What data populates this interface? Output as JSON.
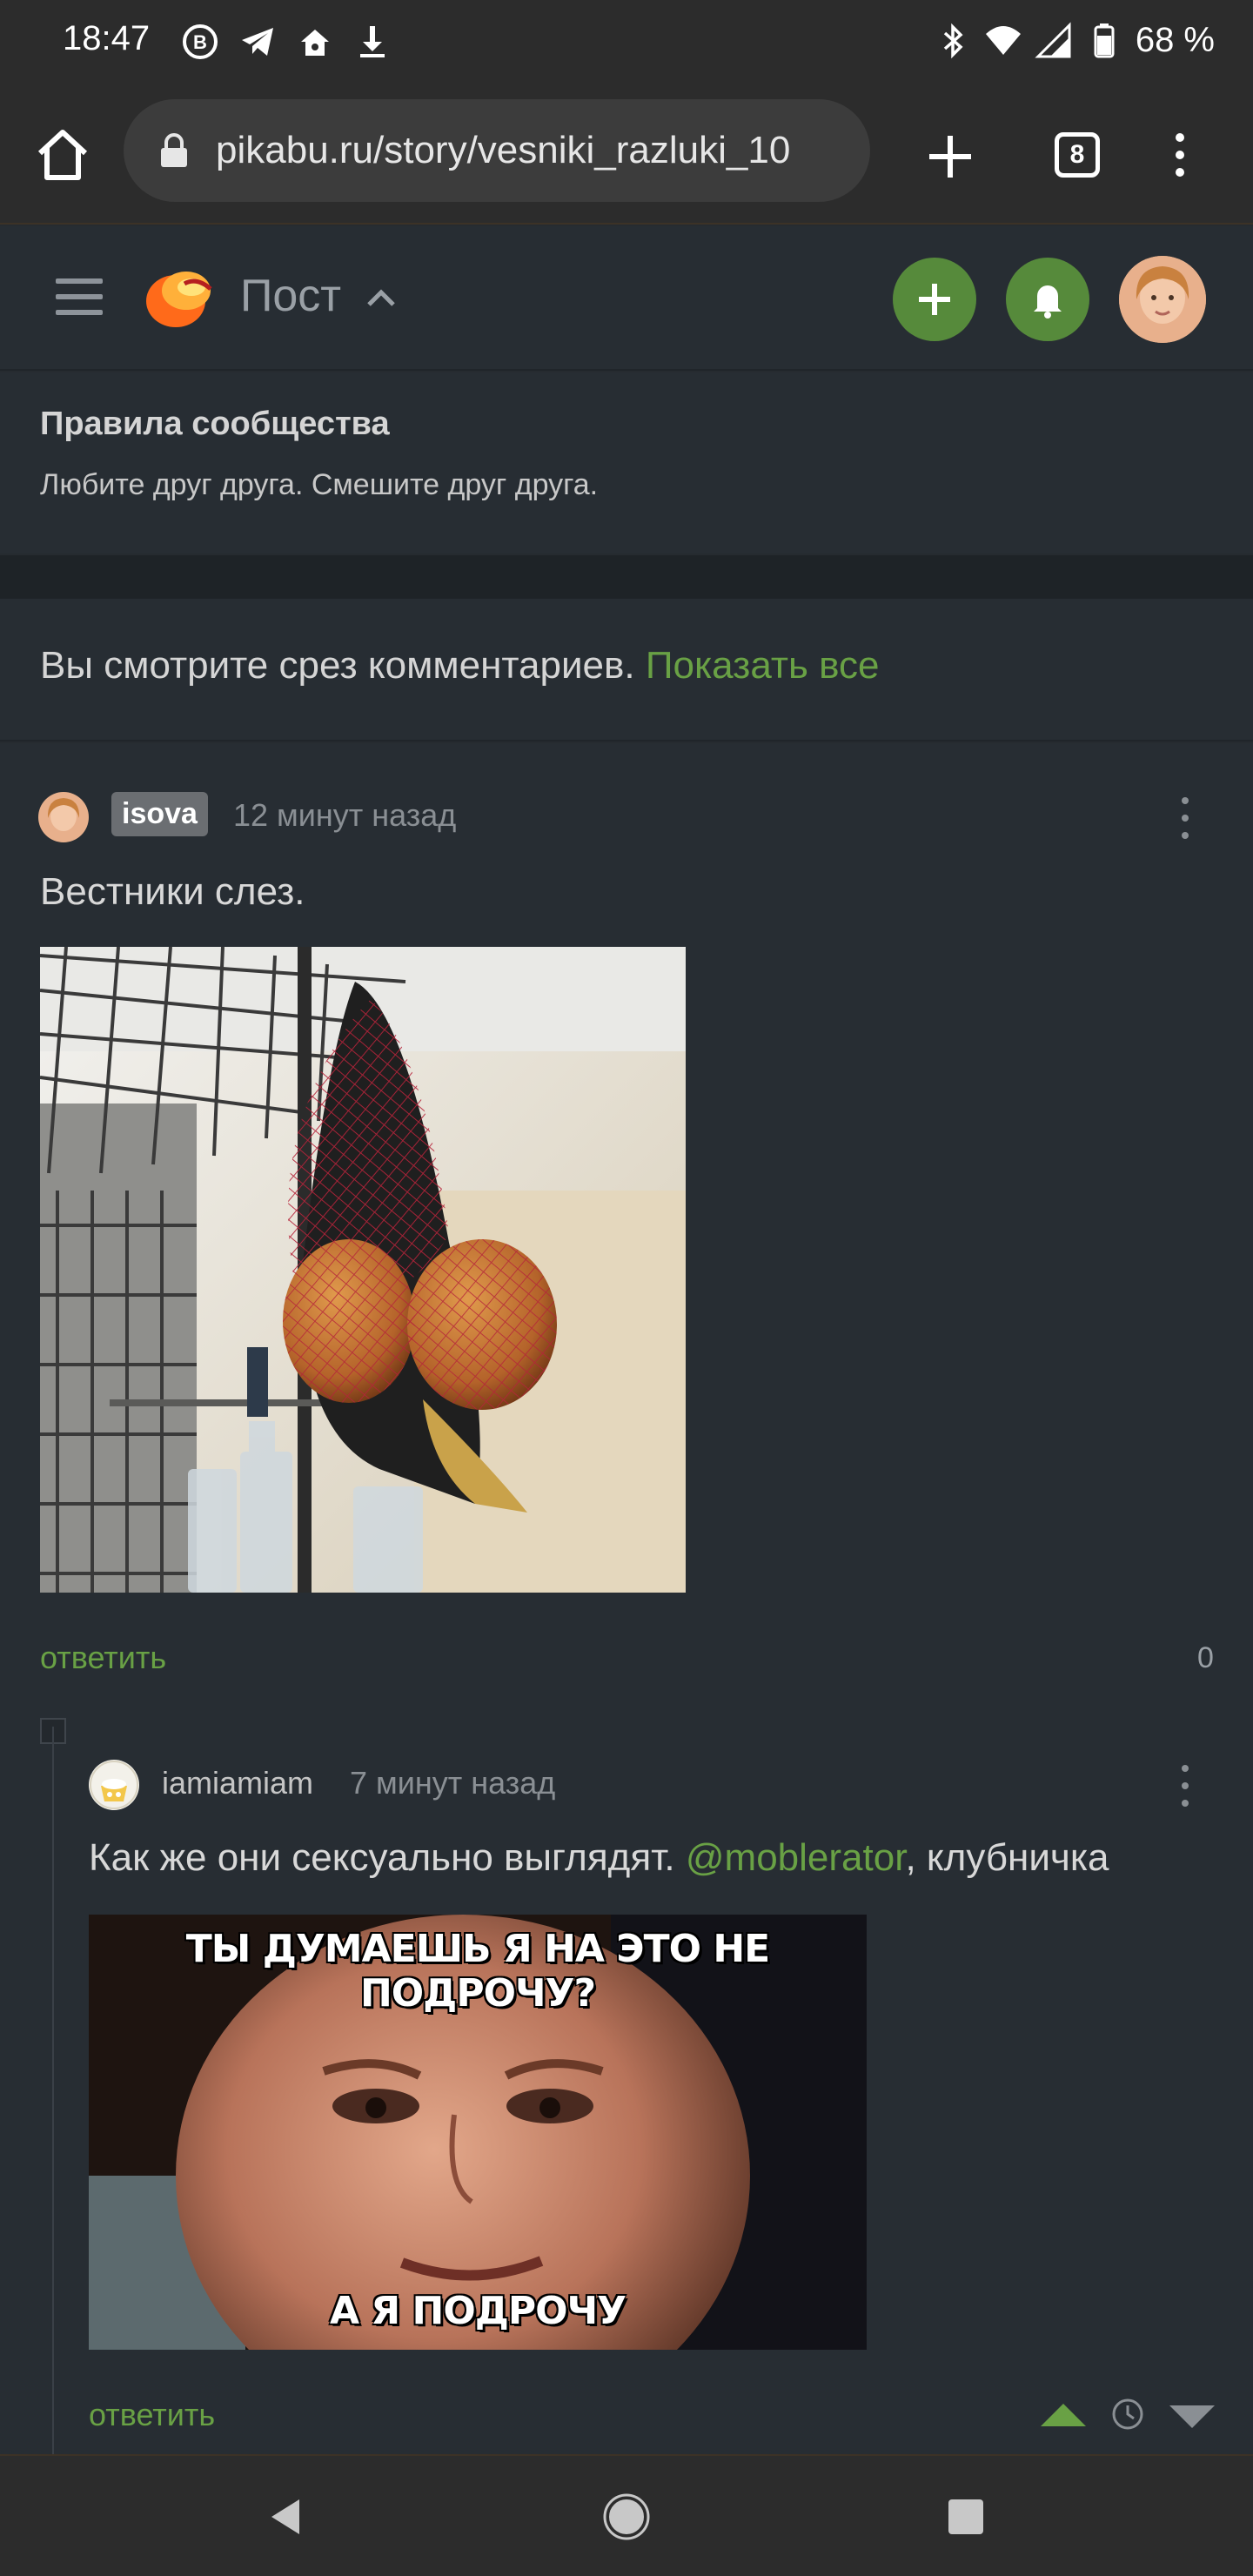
{
  "status_bar": {
    "time": "18:47",
    "battery": "68 %",
    "left_icons": [
      "b-badge-icon",
      "telegram-icon",
      "home-notif-icon",
      "download-icon"
    ],
    "right_icons": [
      "bluetooth-icon",
      "wifi-icon",
      "signal-icon",
      "battery-icon"
    ]
  },
  "browser": {
    "url": "pikabu.ru/story/vesniki_razluki_10",
    "tab_count": "8"
  },
  "header": {
    "title": "Пост"
  },
  "rules": {
    "title": "Правила сообщества",
    "text": "Любите друг друга. Смешите друг друга."
  },
  "slice_notice": {
    "text": "Вы смотрите срез комментариев.",
    "link": "Показать все"
  },
  "comments": [
    {
      "user": "isova",
      "time": "12 минут назад",
      "text": "Вестники слез.",
      "reply_label": "ответить",
      "score": "0"
    },
    {
      "user": "iamiamiam",
      "time": "7 минут назад",
      "text_before": "Как же они сексуально выглядят.",
      "mention": "@moblerator",
      "text_after": ", клубничка",
      "meme_top": "ТЫ ДУМАЕШЬ Я НА ЭТО НЕ ПОДРОЧУ?",
      "meme_bottom": "А Я ПОДРОЧУ",
      "reply_label": "ответить"
    }
  ],
  "colors": {
    "accent_green": "#69a145",
    "button_green": "#568a3b",
    "background": "#272d33"
  }
}
